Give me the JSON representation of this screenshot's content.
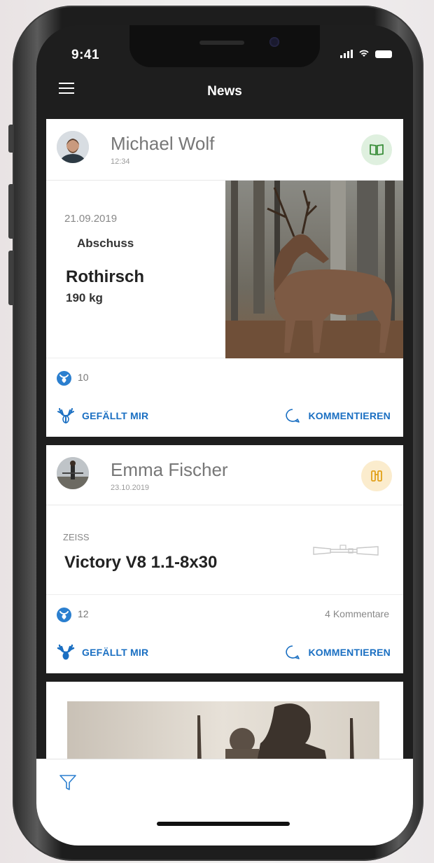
{
  "status_bar": {
    "time": "9:41"
  },
  "header": {
    "title": "News"
  },
  "feed": [
    {
      "author": "Michael Wolf",
      "time": "12:34",
      "badge_icon": "book-icon",
      "date": "21.09.2019",
      "type_label": "Abschuss",
      "title": "Rothirsch",
      "subtitle": "190 kg",
      "likes": "10",
      "like_label": "GEFÄLLT MIR",
      "comment_label": "KOMMENTIEREN"
    },
    {
      "author": "Emma Fischer",
      "time": "23.10.2019",
      "badge_icon": "binoculars-icon",
      "brand": "ZEISS",
      "title": "Victory V8 1.1-8x30",
      "likes": "12",
      "comments": "4 Kommentare",
      "like_label": "GEFÄLLT MIR",
      "comment_label": "KOMMENTIEREN"
    }
  ],
  "colors": {
    "accent": "#1a6fc2",
    "badge_green": "#dff0df",
    "badge_orange": "#fbeccd",
    "bar_dark": "#1e1e1e"
  },
  "bottom_bar": {
    "filter_icon": "filter-icon"
  }
}
